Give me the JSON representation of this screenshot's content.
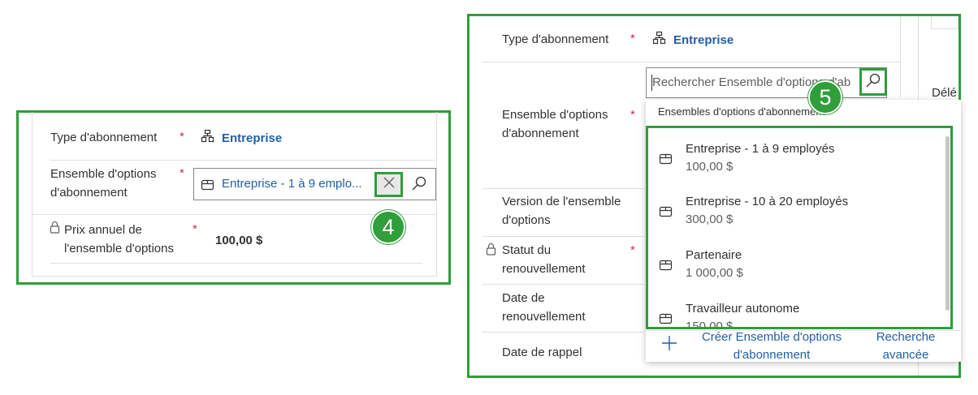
{
  "left_panel": {
    "subscription_type_label": "Type d'abonnement",
    "subscription_type_value": "Entreprise",
    "option_set_label": "Ensemble d'options d'abonnement",
    "option_set_value": "Entreprise - 1 à 9 emplo...",
    "annual_price_label": "Prix annuel de l'ensemble d'options",
    "annual_price_value": "100,00 $",
    "required_mark": "*",
    "callout": "4"
  },
  "right_panel": {
    "subscription_type_label": "Type d'abonnement",
    "subscription_type_value": "Entreprise",
    "option_set_label": "Ensemble d'options d'abonnement",
    "version_label": "Version de l'ensemble d'options",
    "renewal_status_label": "Statut du renouvellement",
    "renewal_date_label": "Date de renouvellement",
    "reminder_date_label": "Date de rappel",
    "required_mark": "*",
    "search_placeholder": "Rechercher Ensemble d'options d'ab",
    "dropdown_header": "Ensembles d'options d'abonnement",
    "results": [
      {
        "name": "Entreprise - 1 à 9 employés",
        "price": "100,00 $"
      },
      {
        "name": "Entreprise - 10 à 20 employés",
        "price": "300,00 $"
      },
      {
        "name": "Partenaire",
        "price": "1 000,00 $"
      },
      {
        "name": "Travailleur autonome",
        "price": "150,00 $"
      }
    ],
    "create_label": "Créer Ensemble d'options d'abonnement",
    "advanced_search_label": "Recherche avancée",
    "side_truncated_label": "Délé",
    "callout": "5"
  },
  "colors": {
    "highlight_green": "#2f9e3b",
    "link_blue": "#1f5fa8",
    "required_red": "#c4314b"
  }
}
